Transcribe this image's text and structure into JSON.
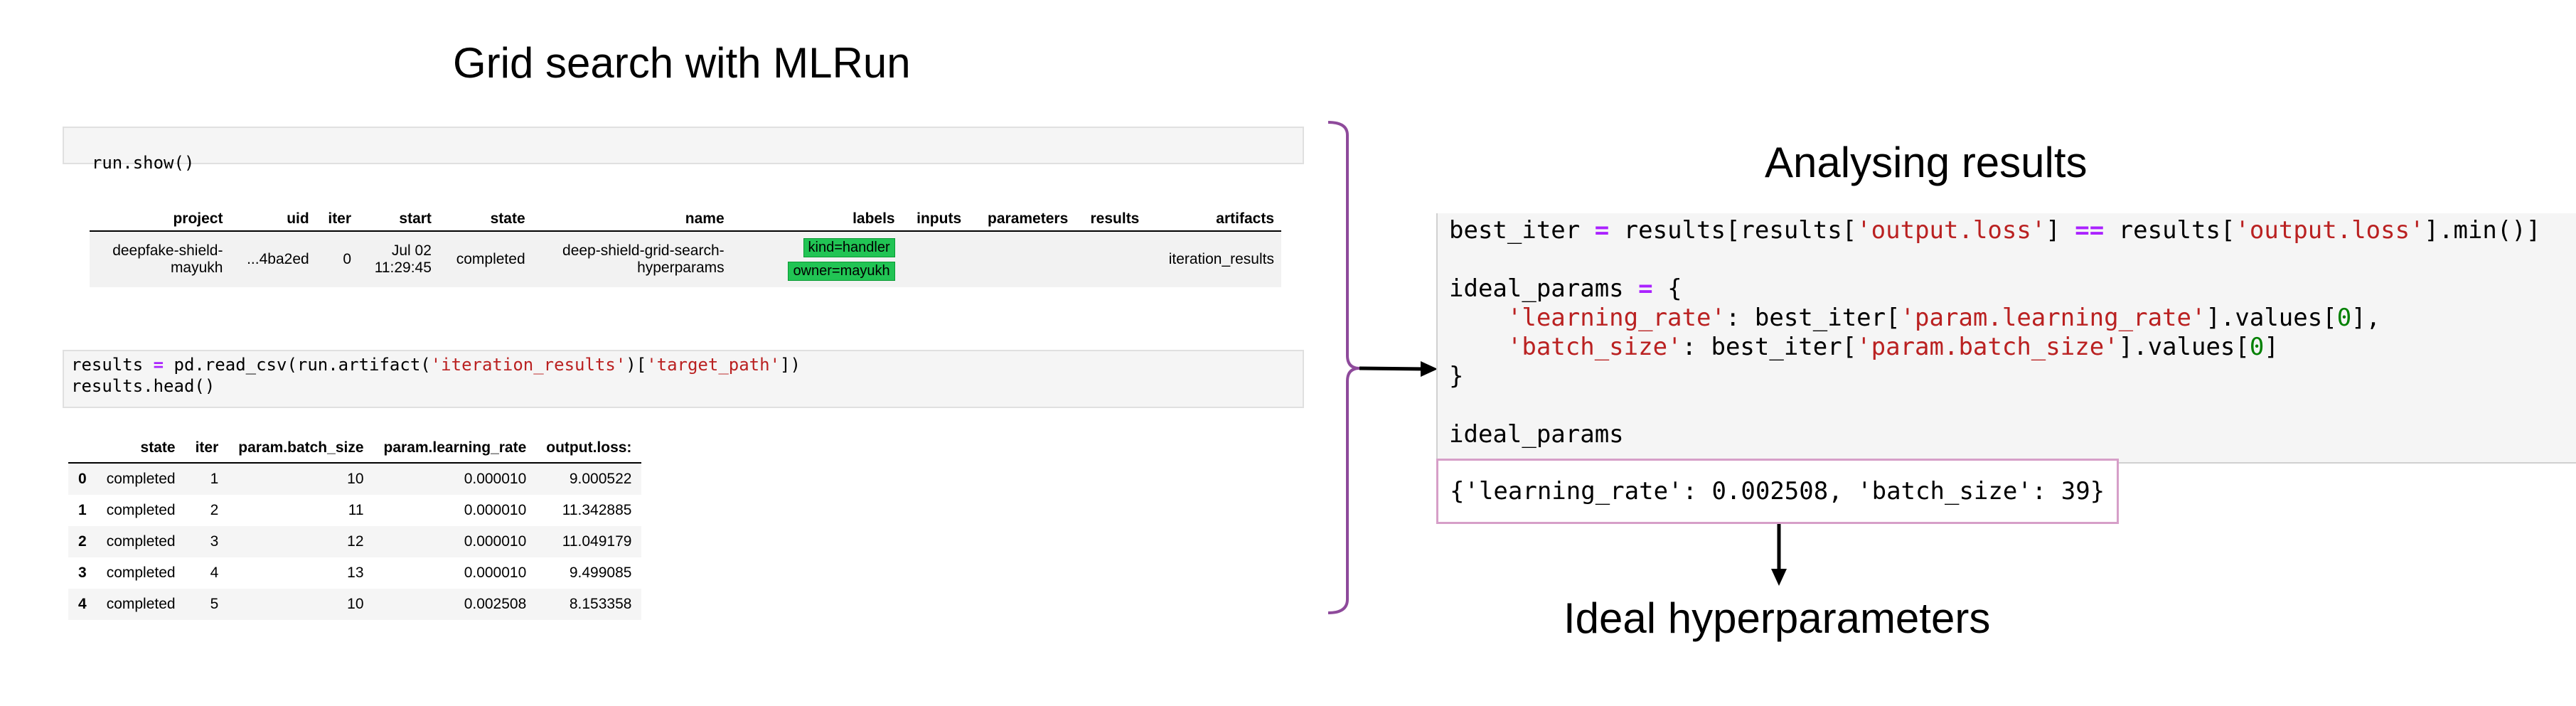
{
  "left_title": "Grid search with MLRun",
  "right_title": "Analysing results",
  "bottom_title": "Ideal hyperparameters",
  "cell1": {
    "code": "run.show()"
  },
  "run_table": {
    "headers": [
      "project",
      "uid",
      "iter",
      "start",
      "state",
      "name",
      "labels",
      "inputs",
      "parameters",
      "results",
      "artifacts"
    ],
    "row": {
      "project_line1": "deepfake-shield-",
      "project_line2": "mayukh",
      "uid": "...4ba2ed",
      "iter": "0",
      "start_line1": "Jul 02",
      "start_line2": "11:29:45",
      "state": "completed",
      "name_line1": "deep-shield-grid-search-",
      "name_line2": "hyperparams",
      "labels": [
        "kind=handler",
        "owner=mayukh"
      ],
      "inputs": "",
      "parameters": "",
      "results": "",
      "artifacts": "iteration_results"
    }
  },
  "cell2": {
    "line1_a": "results ",
    "line1_op": "=",
    "line1_b": " pd.read_csv(run.artifact(",
    "line1_s1": "'iteration_results'",
    "line1_c": ")[",
    "line1_s2": "'target_path'",
    "line1_d": "])",
    "line2": "results.head()"
  },
  "results_table": {
    "headers": [
      "",
      "state",
      "iter",
      "param.batch_size",
      "param.learning_rate",
      "output.loss:"
    ],
    "rows": [
      [
        "0",
        "completed",
        "1",
        "10",
        "0.000010",
        "9.000522"
      ],
      [
        "1",
        "completed",
        "2",
        "11",
        "0.000010",
        "11.342885"
      ],
      [
        "2",
        "completed",
        "3",
        "12",
        "0.000010",
        "11.049179"
      ],
      [
        "3",
        "completed",
        "4",
        "13",
        "0.000010",
        "9.499085"
      ],
      [
        "4",
        "completed",
        "5",
        "10",
        "0.002508",
        "8.153358"
      ]
    ]
  },
  "analysis_code": {
    "l1_a": "best_iter ",
    "l1_op": "=",
    "l1_b": " results[results[",
    "l1_s1": "'output.loss'",
    "l1_c": "] ",
    "l1_op2": "==",
    "l1_d": " results[",
    "l1_s2": "'output.loss'",
    "l1_e": "].min()]",
    "l3_a": "ideal_params ",
    "l3_op": "=",
    "l3_b": " {",
    "l4_indent": "    ",
    "l4_s1": "'learning_rate'",
    "l4_a": ": best_iter[",
    "l4_s2": "'param.learning_rate'",
    "l4_b": "].values[",
    "l4_n": "0",
    "l4_c": "],",
    "l5_indent": "    ",
    "l5_s1": "'batch_size'",
    "l5_a": ": best_iter[",
    "l5_s2": "'param.batch_size'",
    "l5_b": "].values[",
    "l5_n": "0",
    "l5_c": "]",
    "l6": "}",
    "l8": "ideal_params"
  },
  "output": "{'learning_rate': 0.002508, 'batch_size': 39}",
  "colors": {
    "brace": "#8e4a9b",
    "output_border": "#d69fc8",
    "label_green": "#21c454"
  }
}
